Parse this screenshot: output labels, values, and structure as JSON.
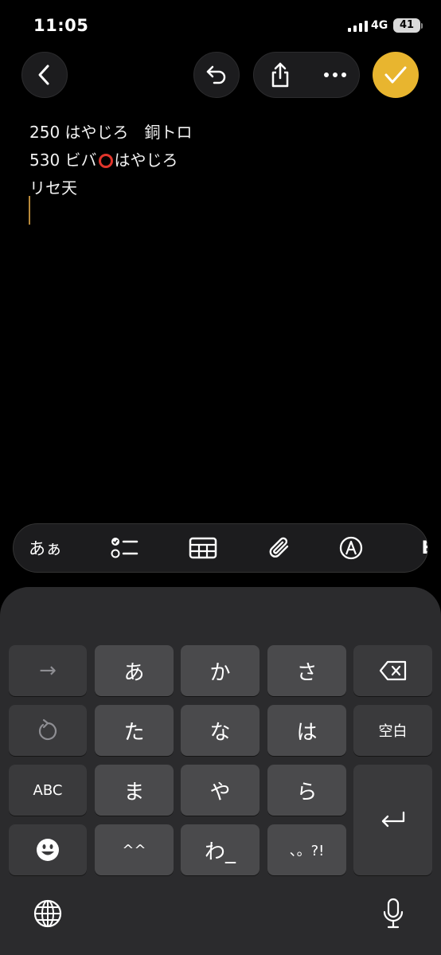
{
  "status_bar": {
    "time": "11:05",
    "network": "4G",
    "battery": "41"
  },
  "note": {
    "line1": "250 はやじろ　銅トロ",
    "line2_before": "530 ビバ",
    "line2_after": "はやじろ",
    "line3": "リセ天"
  },
  "format_bar": {
    "text_style_label": "あぁ",
    "partial_item_label": "E"
  },
  "keyboard": {
    "row1": [
      "→",
      "あ",
      "か",
      "さ"
    ],
    "row2": [
      "た",
      "な",
      "は"
    ],
    "space_label": "空白",
    "row3": [
      "ABC",
      "ま",
      "や",
      "ら"
    ],
    "row4": [
      "^^",
      "わ_",
      "、。?!"
    ]
  },
  "colors": {
    "accent": "#e8b52f",
    "cursor": "#b8893a",
    "ring": "#e0352b"
  },
  "icons": [
    "back-chevron-icon",
    "undo-icon",
    "share-icon",
    "more-icon",
    "checkmark-icon",
    "checklist-icon",
    "table-icon",
    "attachment-icon",
    "markup-icon",
    "delete-icon",
    "redo-icon",
    "return-icon",
    "emoji-icon",
    "globe-icon",
    "microphone-icon"
  ]
}
